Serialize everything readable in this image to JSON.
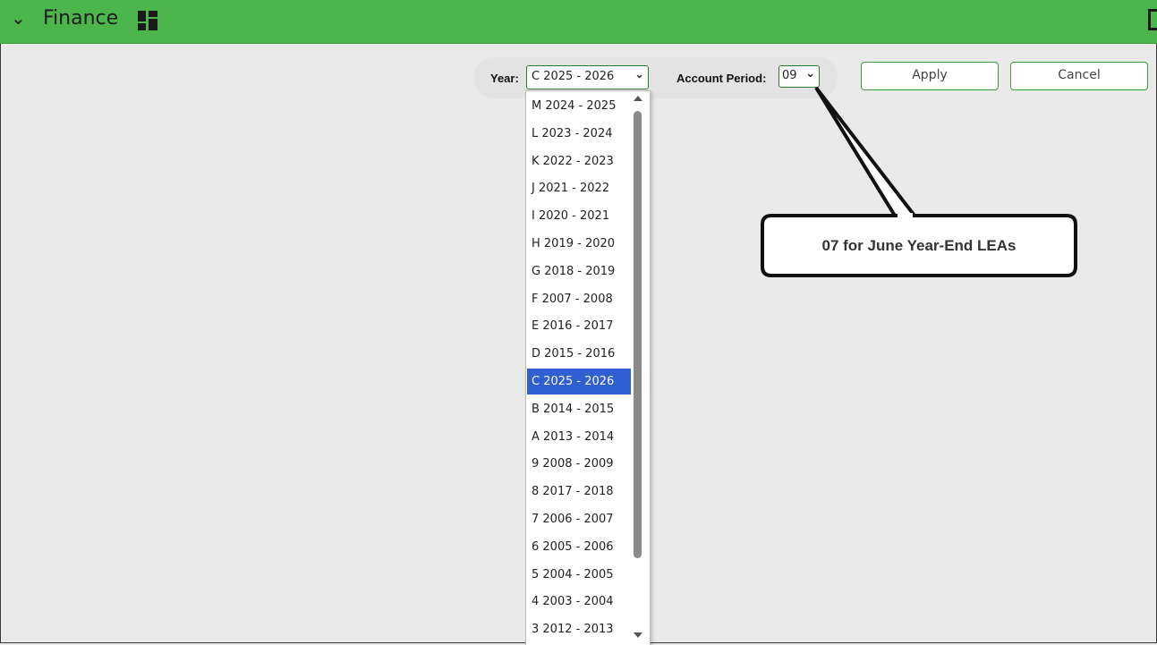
{
  "header": {
    "title": "Finance",
    "collapse_icon": "chevron-down-icon",
    "dashboard_icon": "dashboard-grid-icon",
    "maximize_icon": "maximize-icon",
    "color": "#4cb64c"
  },
  "filters": {
    "year_label": "Year:",
    "year_value": "C 2025 - 2026",
    "period_label": "Account Period:",
    "period_value": "09"
  },
  "buttons": {
    "apply": "Apply",
    "cancel": "Cancel"
  },
  "year_options": [
    "M 2024 - 2025",
    "L 2023 - 2024",
    "K 2022 - 2023",
    "J 2021 - 2022",
    "I 2020 - 2021",
    "H 2019 - 2020",
    "G 2018 - 2019",
    "F 2007 - 2008",
    "E 2016 - 2017",
    "D 2015 - 2016",
    "C 2025 - 2026",
    "B 2014 - 2015",
    "A 2013 - 2014",
    "9 2008 - 2009",
    "8 2017 - 2018",
    "7 2006 - 2007",
    "6 2005 - 2006",
    "5 2004 - 2005",
    "4 2003 - 2004",
    "3 2012 - 2013"
  ],
  "selected_option": "C 2025 - 2026",
  "selection_color": "#2f5fd0",
  "callout": {
    "text": "07 for June Year-End LEAs"
  }
}
